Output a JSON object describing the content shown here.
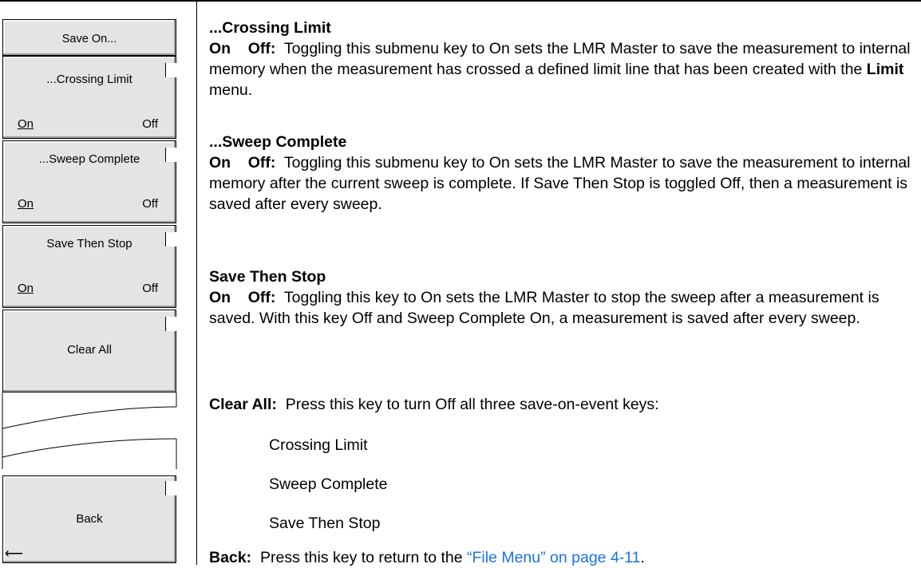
{
  "menu": {
    "title": "Save On...",
    "keys": [
      {
        "label": "...Crossing Limit",
        "on": "On",
        "off": "Off"
      },
      {
        "label": "...Sweep Complete",
        "on": "On",
        "off": "Off"
      },
      {
        "label": "Save Then Stop",
        "on": "On",
        "off": "Off"
      }
    ],
    "clear_all": "Clear All",
    "back": "Back",
    "back_arrow": "⟵"
  },
  "sections": [
    {
      "heading": "...Crossing Limit",
      "term": "On    Off:",
      "body": "Toggling this submenu key to On sets the LMR Master to save the measurement to internal memory when the measurement has crossed a defined limit line that has been created with the",
      "body_bold": "Limit",
      "body_end": "menu."
    },
    {
      "heading": "...Sweep Complete",
      "term": "On    Off:",
      "body": "Toggling this submenu key to On sets the LMR Master to save the measurement to internal memory after the current sweep is complete. If Save Then Stop is toggled Off, then a measurement is saved after every sweep."
    },
    {
      "heading": "Save Then Stop",
      "term": "On    Off:",
      "body": "Toggling this key to On sets the LMR Master to stop the sweep after a measurement is saved. With this key Off and Sweep Complete On, a measurement is saved after every sweep."
    }
  ],
  "clear_all": {
    "term": "Clear All:",
    "body": "Press this key to turn Off all three save-on-event keys:",
    "items": [
      "Crossing Limit",
      "Sweep Complete",
      "Save Then Stop"
    ]
  },
  "back": {
    "term": "Back:",
    "body": "Press this key to return to the",
    "link": "“File Menu” on page 4-11",
    "end": "."
  }
}
